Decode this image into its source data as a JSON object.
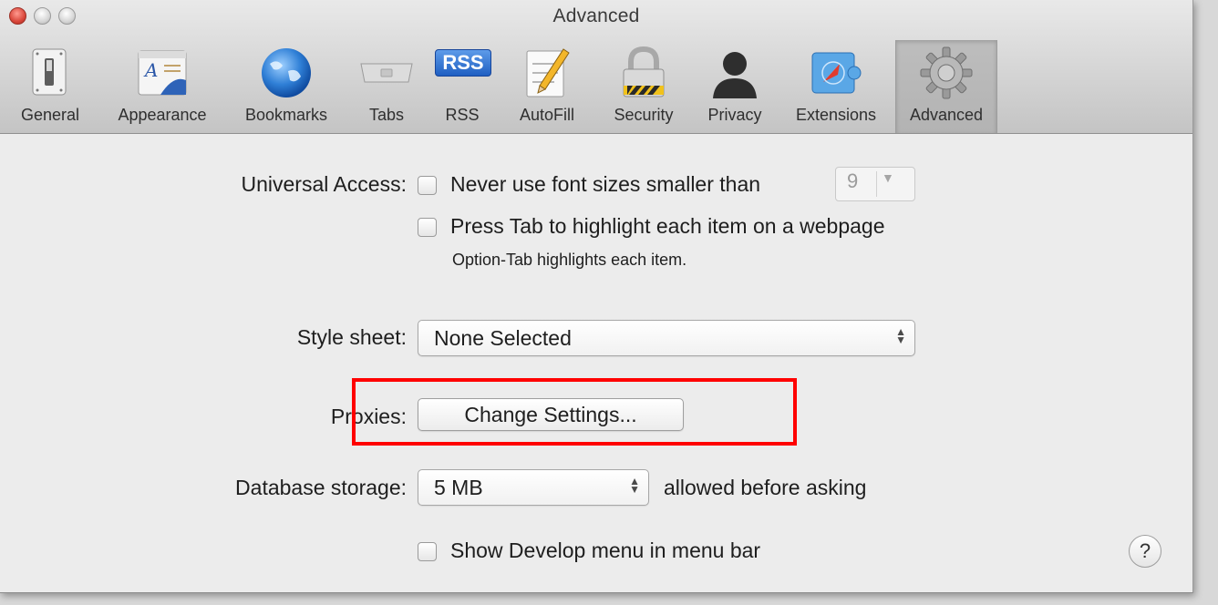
{
  "window": {
    "title": "Advanced"
  },
  "toolbar": {
    "items": [
      {
        "label": "General",
        "icon": "switch-icon"
      },
      {
        "label": "Appearance",
        "icon": "font-panel-icon"
      },
      {
        "label": "Bookmarks",
        "icon": "globe-icon"
      },
      {
        "label": "Tabs",
        "icon": "tabs-icon"
      },
      {
        "label": "RSS",
        "icon": "rss-icon"
      },
      {
        "label": "AutoFill",
        "icon": "pencil-form-icon"
      },
      {
        "label": "Security",
        "icon": "padlock-icon"
      },
      {
        "label": "Privacy",
        "icon": "silhouette-icon"
      },
      {
        "label": "Extensions",
        "icon": "compass-puzzle-icon"
      },
      {
        "label": "Advanced",
        "icon": "gear-icon"
      }
    ],
    "selected": "Advanced",
    "rss_badge": "RSS"
  },
  "universal_access": {
    "label": "Universal Access:",
    "font_size_checkbox": {
      "label": "Never use font sizes smaller than",
      "checked": false
    },
    "font_size_value": "9",
    "tab_checkbox": {
      "label": "Press Tab to highlight each item on a webpage",
      "checked": false
    },
    "tab_hint": "Option-Tab highlights each item."
  },
  "style_sheet": {
    "label": "Style sheet:",
    "value": "None Selected"
  },
  "proxies": {
    "label": "Proxies:",
    "button_label": "Change Settings..."
  },
  "database_storage": {
    "label": "Database storage:",
    "value": "5 MB",
    "suffix": "allowed before asking"
  },
  "develop_menu": {
    "label": "Show Develop menu in menu bar",
    "checked": false
  },
  "help": {
    "label": "?"
  },
  "colors": {
    "highlight": "#ff0000",
    "window_bg": "#ececec"
  }
}
